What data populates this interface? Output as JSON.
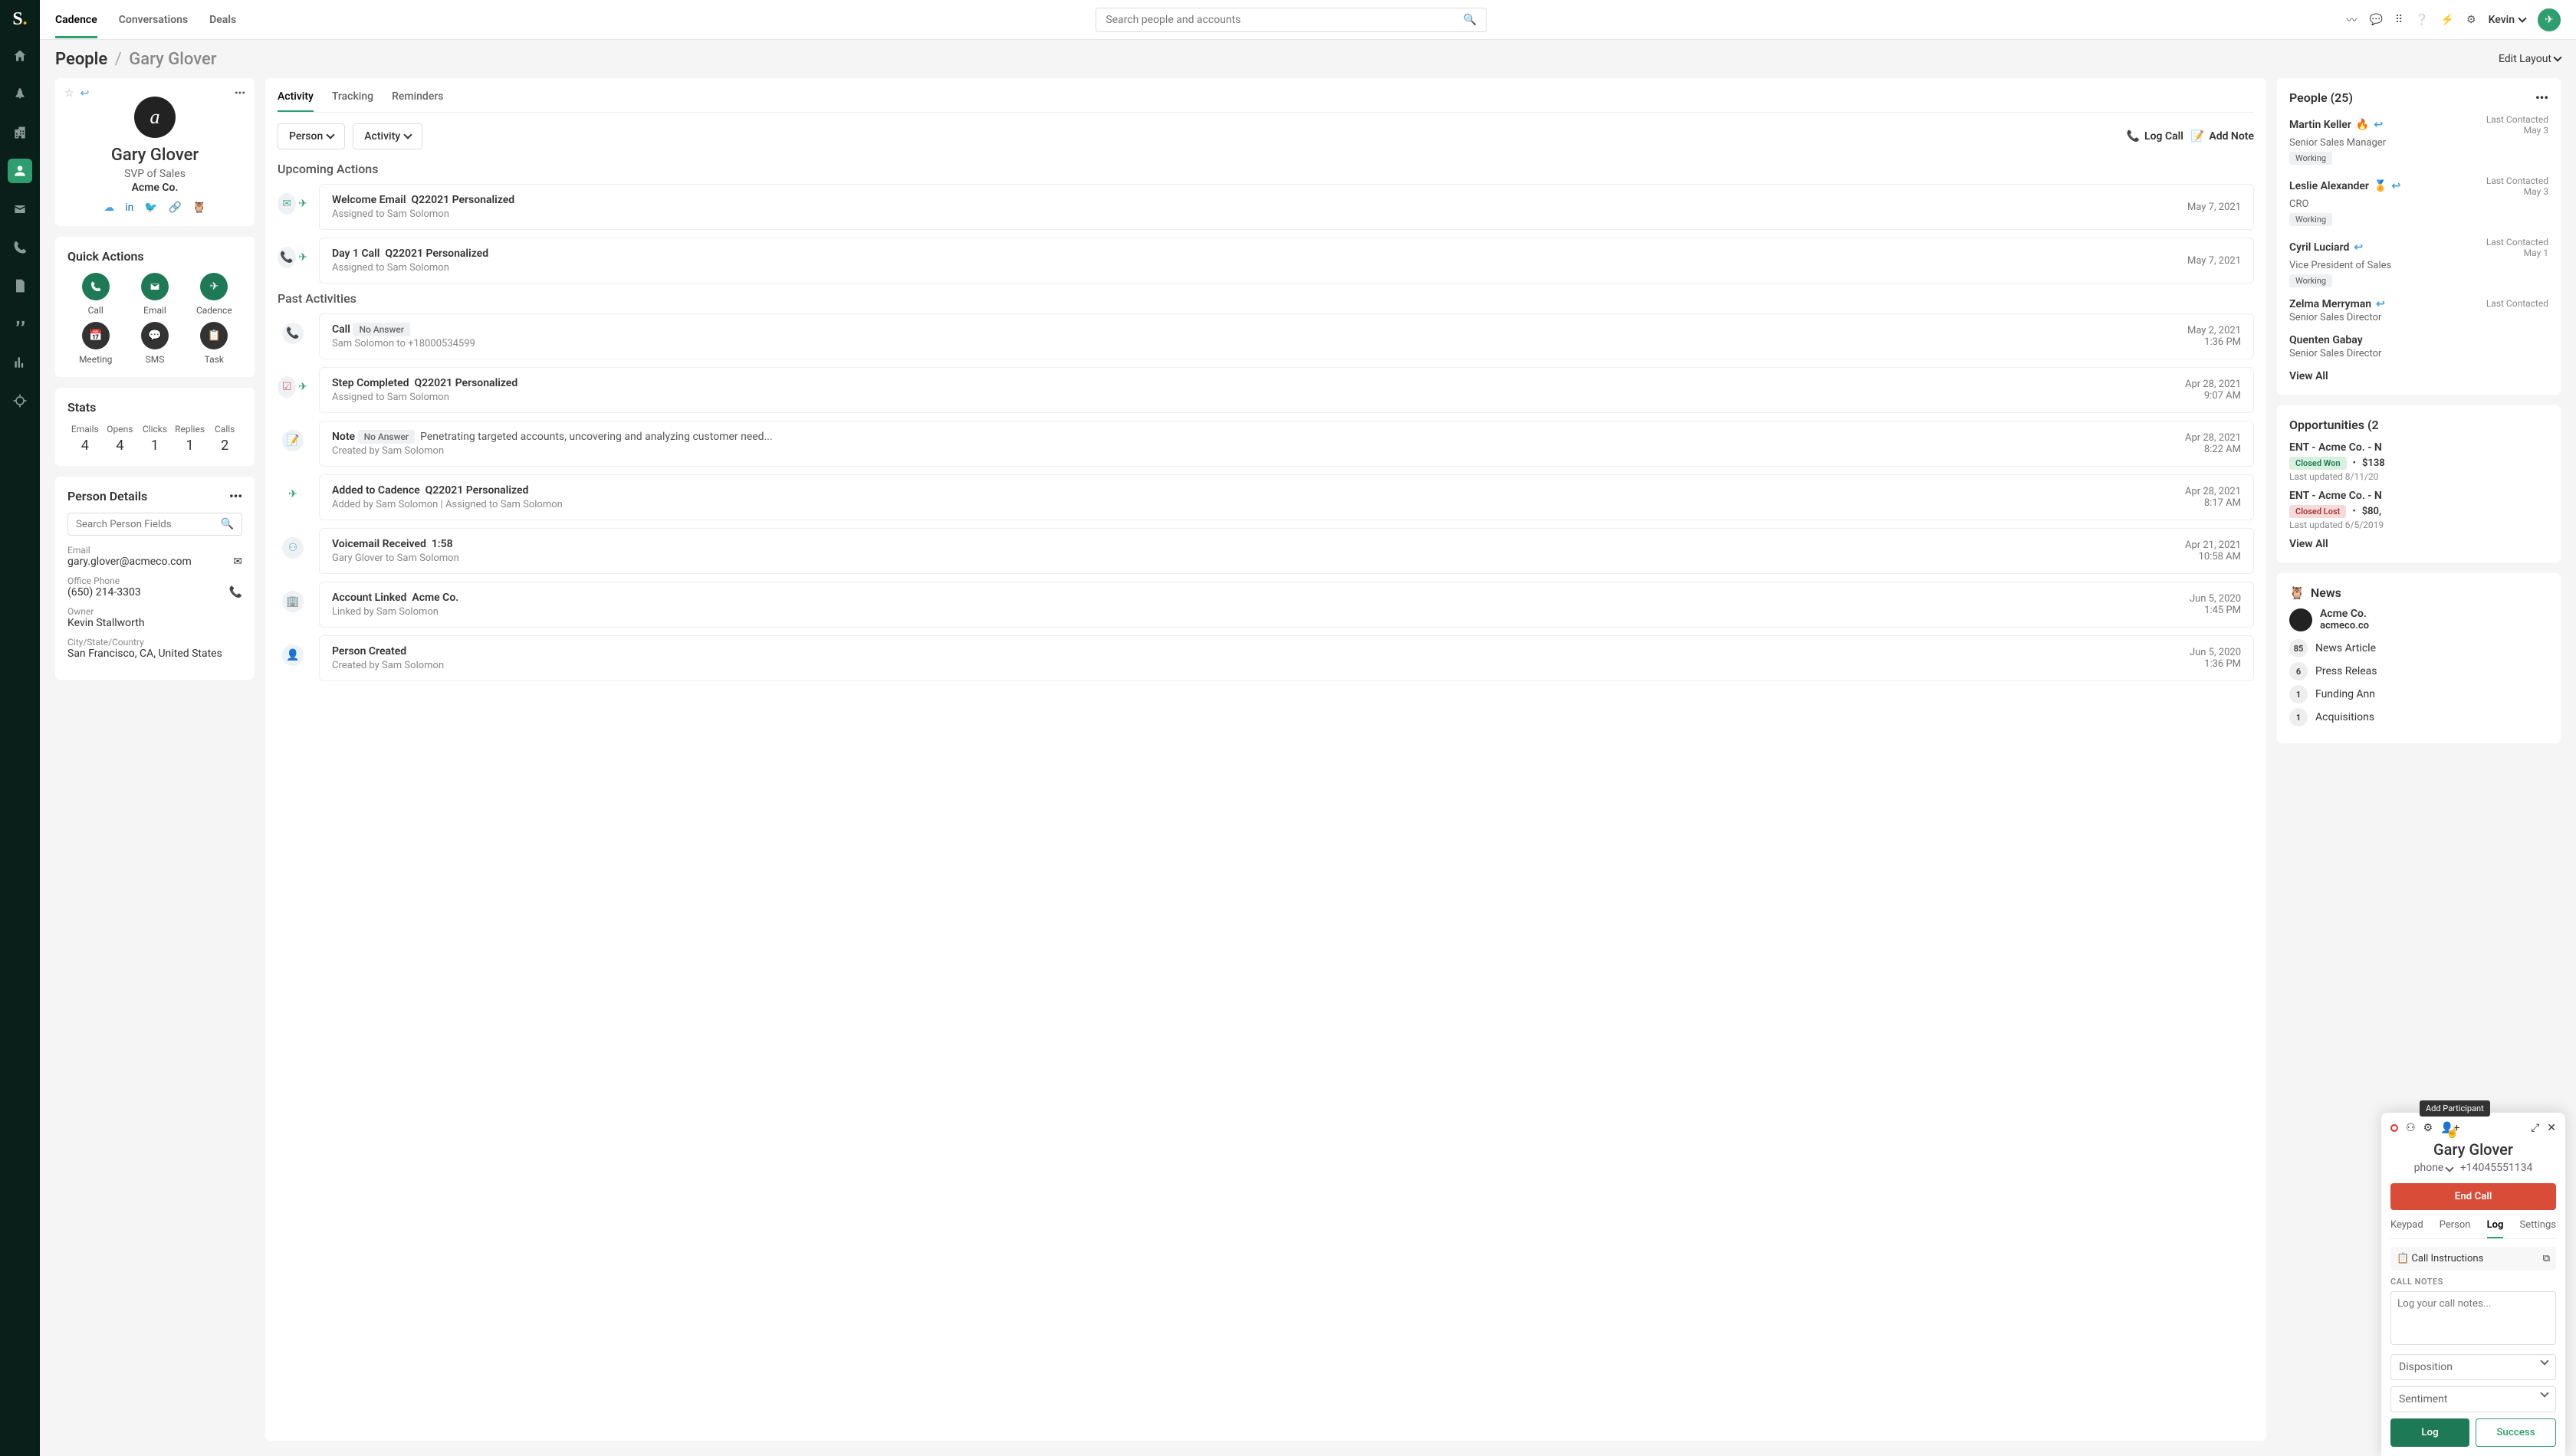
{
  "topnav": {
    "items": [
      "Cadence",
      "Conversations",
      "Deals"
    ],
    "search_placeholder": "Search people and accounts",
    "user_name": "Kevin"
  },
  "breadcrumb": {
    "root": "People",
    "leaf": "Gary Glover",
    "edit": "Edit Layout"
  },
  "profile": {
    "name": "Gary Glover",
    "title": "SVP of Sales",
    "company": "Acme Co."
  },
  "quick_actions": {
    "header": "Quick Actions",
    "items": [
      "Call",
      "Email",
      "Cadence",
      "Meeting",
      "SMS",
      "Task"
    ]
  },
  "stats": {
    "header": "Stats",
    "items": [
      {
        "label": "Emails",
        "value": "4"
      },
      {
        "label": "Opens",
        "value": "4"
      },
      {
        "label": "Clicks",
        "value": "1"
      },
      {
        "label": "Replies",
        "value": "1"
      },
      {
        "label": "Calls",
        "value": "2"
      }
    ]
  },
  "person_details": {
    "header": "Person Details",
    "search_placeholder": "Search Person Fields",
    "fields": [
      {
        "label": "Email",
        "value": "gary.glover@acmeco.com"
      },
      {
        "label": "Office Phone",
        "value": "(650) 214-3303"
      },
      {
        "label": "Owner",
        "value": "Kevin Stallworth"
      },
      {
        "label": "City/State/Country",
        "value": "San Francisco, CA, United States"
      }
    ]
  },
  "activity": {
    "tabs": [
      "Activity",
      "Tracking",
      "Reminders"
    ],
    "filter_person": "Person",
    "filter_activity": "Activity",
    "log_call": "Log Call",
    "add_note": "Add Note",
    "upcoming_h": "Upcoming Actions",
    "past_h": "Past Activities",
    "upcoming": [
      {
        "title": "Welcome Email",
        "tag": "Q22021 Personalized",
        "sub": "Assigned to Sam Solomon",
        "date": "May 7, 2021"
      },
      {
        "title": "Day 1 Call",
        "tag": "Q22021 Personalized",
        "sub": "Assigned to Sam Solomon",
        "date": "May 7, 2021"
      }
    ],
    "past": [
      {
        "title": "Call",
        "badge": "No Answer",
        "sub": "Sam Solomon to +18000534599",
        "date": "May 2, 2021",
        "time": "1:36 PM"
      },
      {
        "title": "Step Completed",
        "tag": "Q22021 Personalized",
        "sub": "Assigned to Sam Solomon",
        "date": "Apr 28, 2021",
        "time": "9:07 AM"
      },
      {
        "title": "Note",
        "badge": "No Answer",
        "extra": "Penetrating targeted accounts, uncovering and analyzing customer need...",
        "sub": "Created by Sam Solomon",
        "date": "Apr 28, 2021",
        "time": "8:22 AM"
      },
      {
        "title": "Added to Cadence",
        "tag": "Q22021 Personalized",
        "sub": "Added by Sam Solomon | Assigned to Sam Solomon",
        "date": "Apr 28, 2021",
        "time": "8:17 AM"
      },
      {
        "title": "Voicemail Received",
        "tag_plain": "1:58",
        "sub": "Gary Glover to Sam Solomon",
        "date": "Apr 21, 2021",
        "time": "10:58 AM"
      },
      {
        "title": "Account Linked",
        "tag": "Acme Co.",
        "sub": "Linked by Sam Solomon",
        "date": "Jun 5, 2020",
        "time": "1:45 PM"
      },
      {
        "title": "Person Created",
        "sub": "Created by Sam Solomon",
        "date": "Jun 5, 2020",
        "time": "1:36 PM"
      }
    ]
  },
  "people_panel": {
    "header": "People (25)",
    "items": [
      {
        "name": "Martin Keller",
        "title": "Senior Sales Manager",
        "badge": "Working",
        "lc": "Last Contacted",
        "lcd": "May 3"
      },
      {
        "name": "Leslie Alexander",
        "title": "CRO",
        "badge": "Working",
        "lc": "Last Contacted",
        "lcd": "May 3"
      },
      {
        "name": "Cyril Luciard",
        "title": "Vice President of Sales",
        "badge": "Working",
        "lc": "Last Contacted",
        "lcd": "May 1"
      },
      {
        "name": "Zelma Merryman",
        "title": "Senior Sales Director",
        "lc": "Last Contacted",
        "lcd": ""
      },
      {
        "name": "Quenten Gabay",
        "title": "Senior Sales Director"
      }
    ],
    "view_all": "View All"
  },
  "opportunities": {
    "header": "Opportunities (2",
    "items": [
      {
        "name": "ENT - Acme Co. - N",
        "badge": "Closed Won",
        "amount": "$138",
        "updated": "Last updated 8/11/20"
      },
      {
        "name": "ENT - Acme Co. - N",
        "badge": "Closed Lost",
        "amount": "$80,",
        "updated": "Last updated 6/5/2019"
      }
    ],
    "view_all": "View All"
  },
  "news": {
    "header": "News",
    "company": "Acme Co.",
    "domain": "acmeco.co",
    "rows": [
      {
        "count": "85",
        "label": "News Article"
      },
      {
        "count": "6",
        "label": "Press Releas"
      },
      {
        "count": "1",
        "label": "Funding Ann"
      },
      {
        "count": "1",
        "label": "Acquisitions"
      }
    ]
  },
  "call_panel": {
    "tooltip": "Add Participant",
    "name": "Gary Glover",
    "phone_label": "phone",
    "phone": "+14045551134",
    "end_call": "End Call",
    "tabs": [
      "Keypad",
      "Person",
      "Log",
      "Settings"
    ],
    "instructions": "Call Instructions",
    "notes_h": "CALL NOTES",
    "notes_placeholder": "Log your call notes...",
    "disposition": "Disposition",
    "sentiment": "Sentiment",
    "log_btn": "Log",
    "success_btn": "Success"
  }
}
